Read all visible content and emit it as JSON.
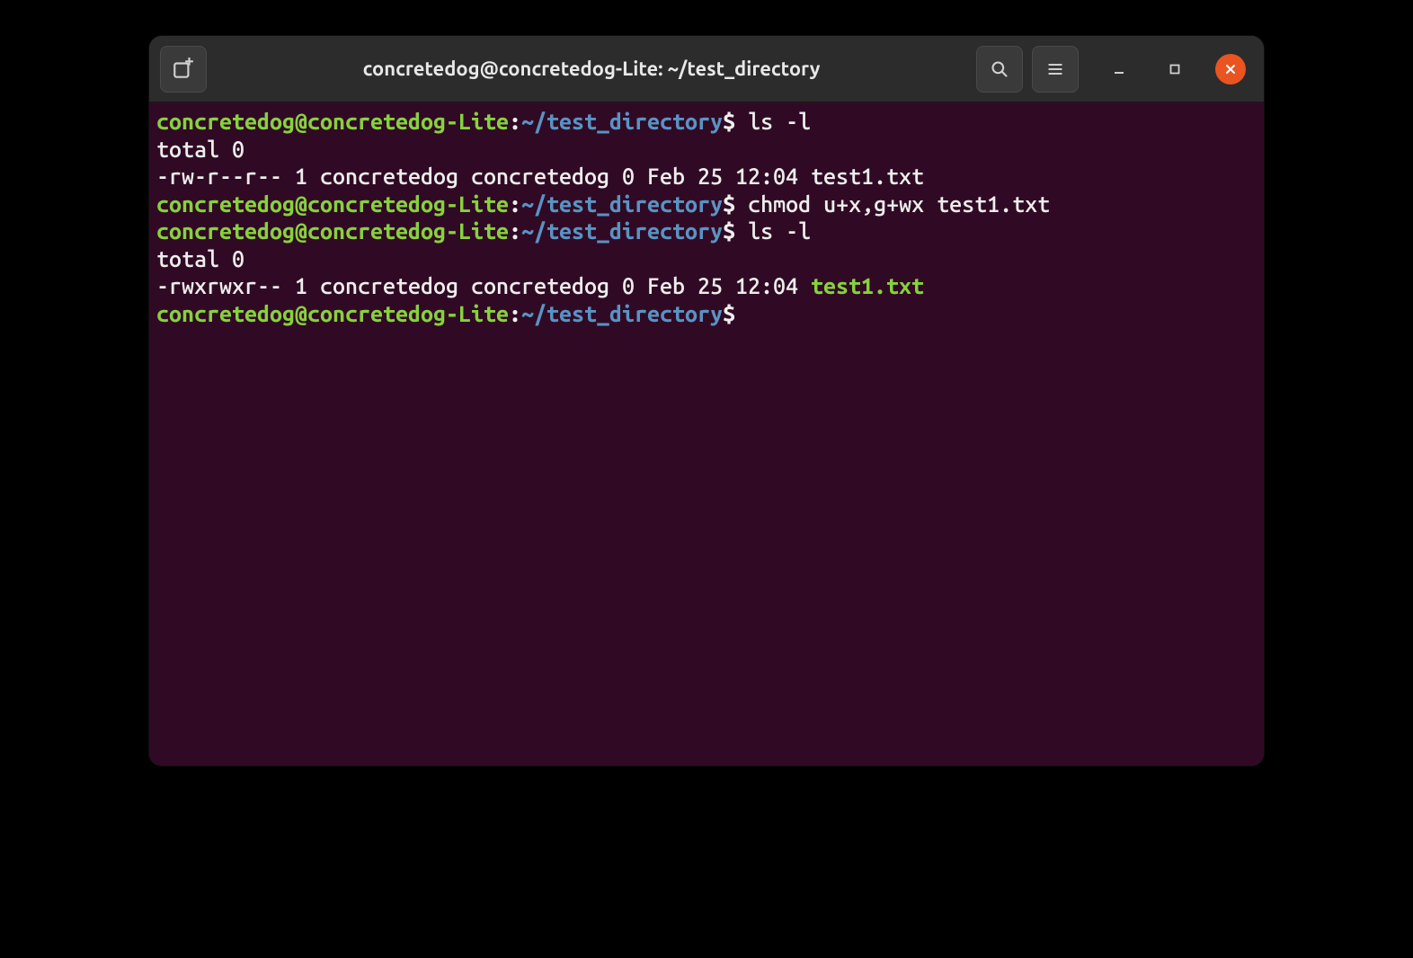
{
  "titlebar": {
    "title": "concretedog@concretedog-Lite: ~/test_directory"
  },
  "prompt": {
    "user_host": "concretedog@concretedog-Lite",
    "colon": ":",
    "path": "~/test_directory",
    "dollar": "$ "
  },
  "lines": [
    {
      "type": "prompt",
      "cmd": "ls -l"
    },
    {
      "type": "output",
      "text": "total 0"
    },
    {
      "type": "output",
      "text": "-rw-r--r-- 1 concretedog concretedog 0 Feb 25 12:04 test1.txt"
    },
    {
      "type": "prompt",
      "cmd": "chmod u+x,g+wx test1.txt"
    },
    {
      "type": "prompt",
      "cmd": "ls -l"
    },
    {
      "type": "output",
      "text": "total 0"
    },
    {
      "type": "output_exec",
      "prefix": "-rwxrwxr-- 1 concretedog concretedog 0 Feb 25 12:04 ",
      "file": "test1.txt"
    },
    {
      "type": "prompt",
      "cmd": ""
    }
  ]
}
